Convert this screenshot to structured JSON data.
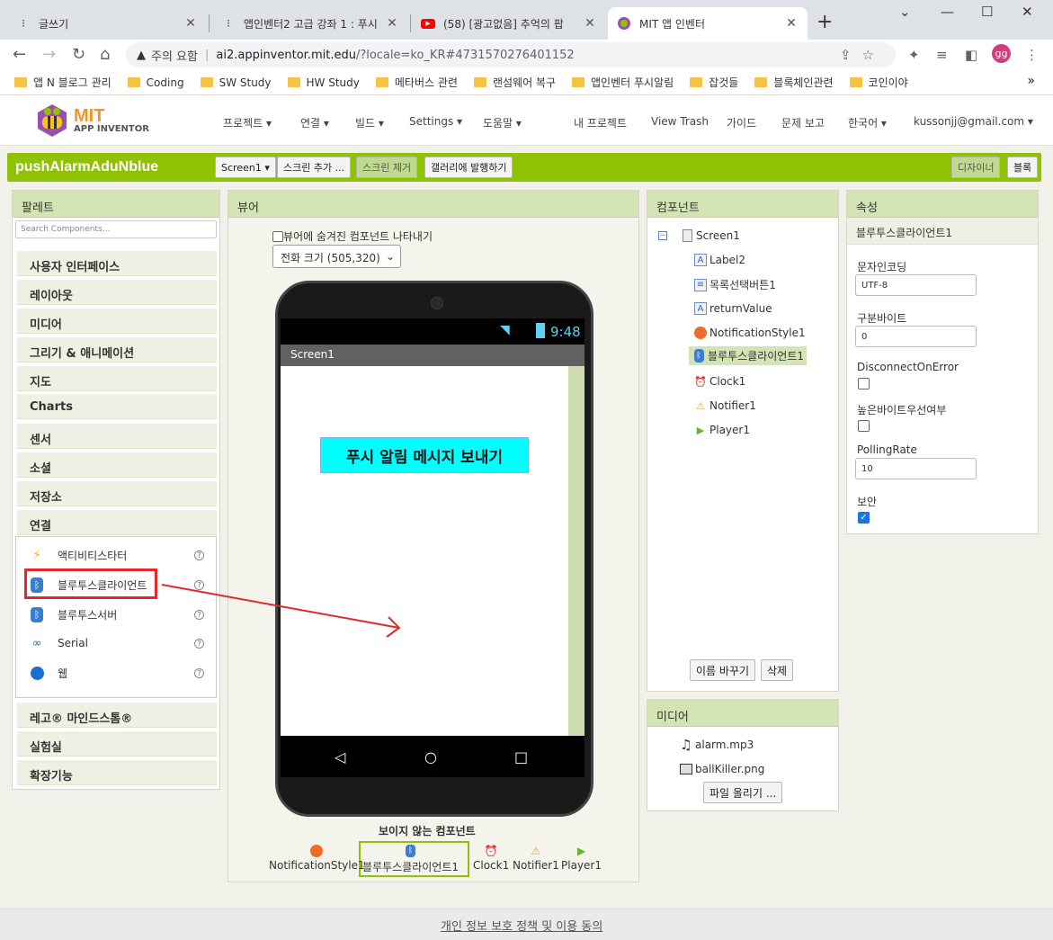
{
  "browser": {
    "tabs": [
      {
        "title": "글쓰기",
        "icon": "tistory-icon"
      },
      {
        "title": "앱인벤터2 고급 강좌 1 : 푸시",
        "icon": "tistory-icon"
      },
      {
        "title": "(58) [광고없음] 추억의 팝",
        "icon": "youtube-icon"
      },
      {
        "title": "MIT 앱 인벤터",
        "icon": "appinventor-icon"
      }
    ],
    "security_label": "주의 요함",
    "url_host": "ai2.appinventor.mit.edu",
    "url_path": "/?locale=ko_KR#4731570276401152",
    "profile_initials": "gg",
    "bookmarks": [
      "앱 N 블로그 관리",
      "Coding",
      "SW Study",
      "HW Study",
      "메타버스 관련",
      "랜섬웨어 복구",
      "앱인벤터 푸시알림",
      "잡것들",
      "블록체인관련",
      "코인이야"
    ]
  },
  "app": {
    "logo_mit": "MIT",
    "logo_ai": "APP INVENTOR",
    "menu": [
      "프로젝트 ▾",
      "연결 ▾",
      "빌드 ▾",
      "Settings ▾",
      "도움말 ▾",
      "내 프로젝트",
      "View Trash",
      "가이드",
      "문제 보고",
      "한국어 ▾",
      "kussonjj@gmail.com ▾"
    ]
  },
  "project": {
    "name": "pushAlarmAduNblue",
    "screen_select": "Screen1 ▾",
    "add_screen": "스크린 추가 ...",
    "remove_screen": "스크린 제거",
    "publish_gallery": "갤러리에 발행하기",
    "designer": "디자이너",
    "blocks": "블록"
  },
  "palette": {
    "title": "팔레트",
    "search_placeholder": "Search Components...",
    "categories_top": [
      "사용자 인터페이스",
      "레이아웃",
      "미디어",
      "그리기 & 애니메이션",
      "지도",
      "Charts",
      "센서",
      "소셜",
      "저장소",
      "연결"
    ],
    "connect_items": [
      {
        "label": "액티비티스타터",
        "icon": "lightning-icon"
      },
      {
        "label": "블루투스클라이언트",
        "icon": "bluetooth-icon"
      },
      {
        "label": "블루투스서버",
        "icon": "bluetooth-icon"
      },
      {
        "label": "Serial",
        "icon": "serial-icon"
      },
      {
        "label": "웹",
        "icon": "globe-icon"
      }
    ],
    "categories_bottom": [
      "레고® 마인드스톰®",
      "실험실",
      "확장기능"
    ]
  },
  "viewer": {
    "title": "뷰어",
    "show_hidden": "뷰어에 숨겨진 컴포넌트 나타내기",
    "size_select": "전화 크기 (505,320)",
    "clock": "9:48",
    "screen_title": "Screen1",
    "button_text": "푸시 알림 메시지 보내기",
    "nonvisible_title": "보이지 않는 컴포넌트",
    "nonvisible": [
      "NotificationStyle1",
      "블루투스클라이언트1",
      "Clock1",
      "Notifier1",
      "Player1"
    ]
  },
  "components": {
    "title": "컴포넌트",
    "root": "Screen1",
    "items": [
      "Label2",
      "목록선택버튼1",
      "returnValue",
      "NotificationStyle1",
      "블루투스클라이언트1",
      "Clock1",
      "Notifier1",
      "Player1"
    ],
    "rename": "이름 바꾸기",
    "delete": "삭제"
  },
  "media": {
    "title": "미디어",
    "files": [
      "alarm.mp3",
      "ballKiller.png"
    ],
    "upload": "파일 올리기 ..."
  },
  "properties": {
    "title": "속성",
    "component": "블루투스클라이언트1",
    "charset_label": "문자인코딩",
    "charset_value": "UTF-8",
    "delimiter_label": "구분바이트",
    "delimiter_value": "0",
    "disconnect_label": "DisconnectOnError",
    "highbyte_label": "높은바이트우선여부",
    "polling_label": "PollingRate",
    "polling_value": "10",
    "secure_label": "보안",
    "secure_checked": true
  },
  "footer": {
    "privacy": "개인 정보 보호 정책 및 이용 동의"
  },
  "colors": {
    "accent_green": "#8fc202",
    "panel_header": "#d3e3b4",
    "annotation_red": "#e2282b",
    "phone_button": "#00ffff"
  }
}
